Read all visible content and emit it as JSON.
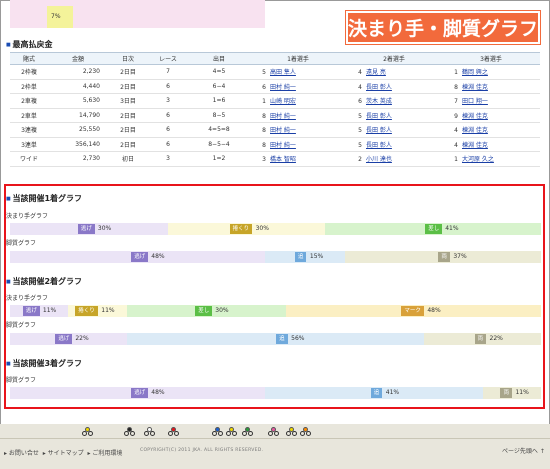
{
  "top_cell": "7%",
  "banner_title": "決まり手・脚質グラフ",
  "payout": {
    "title": "最高払戻金",
    "headers": [
      "賭式",
      "金額",
      "日次",
      "レース",
      "出目",
      "1着選手",
      "2着選手",
      "3着選手"
    ],
    "rows": [
      {
        "type": "2枠複",
        "amount": "2,230",
        "day": "2日目",
        "race": "7",
        "result": "4=5",
        "p1": {
          "num": "5",
          "name": "高田 隼人"
        },
        "p2": {
          "num": "4",
          "name": "遠見 亮"
        },
        "p3": {
          "num": "1",
          "name": "鶴岡 興之"
        }
      },
      {
        "type": "2枠単",
        "amount": "4,440",
        "day": "2日目",
        "race": "6",
        "result": "6−4",
        "p1": {
          "num": "6",
          "name": "田村 純一"
        },
        "p2": {
          "num": "4",
          "name": "長田 彰人"
        },
        "p3": {
          "num": "8",
          "name": "棟淵 佳克"
        }
      },
      {
        "type": "2車複",
        "amount": "5,630",
        "day": "3日目",
        "race": "3",
        "result": "1=6",
        "p1": {
          "num": "1",
          "name": "山崎 明宏"
        },
        "p2": {
          "num": "6",
          "name": "茨木 英成"
        },
        "p3": {
          "num": "7",
          "name": "田口 翔一"
        }
      },
      {
        "type": "2車単",
        "amount": "14,790",
        "day": "2日目",
        "race": "6",
        "result": "8−5",
        "p1": {
          "num": "8",
          "name": "田村 純一"
        },
        "p2": {
          "num": "5",
          "name": "長田 彰人"
        },
        "p3": {
          "num": "9",
          "name": "棟淵 佳克"
        }
      },
      {
        "type": "3連複",
        "amount": "25,550",
        "day": "2日目",
        "race": "6",
        "result": "4=5=8",
        "p1": {
          "num": "8",
          "name": "田村 純一"
        },
        "p2": {
          "num": "5",
          "name": "長田 彰人"
        },
        "p3": {
          "num": "4",
          "name": "棟淵 佳克"
        }
      },
      {
        "type": "3連単",
        "amount": "356,140",
        "day": "2日目",
        "race": "6",
        "result": "8−5−4",
        "p1": {
          "num": "8",
          "name": "田村 純一"
        },
        "p2": {
          "num": "5",
          "name": "長田 彰人"
        },
        "p3": {
          "num": "4",
          "name": "棟淵 佳克"
        }
      },
      {
        "type": "ワイド",
        "amount": "2,730",
        "day": "初日",
        "race": "3",
        "result": "1=2",
        "p1": {
          "num": "3",
          "name": "橋本 智昭"
        },
        "p2": {
          "num": "2",
          "name": "小川 達也"
        },
        "p3": {
          "num": "1",
          "name": "大河原 久之"
        }
      }
    ]
  },
  "graphs": [
    {
      "title": "当該開催1着グラフ",
      "rows": [
        {
          "label": "決まり手グラフ",
          "segments": [
            {
              "name": "逃げ",
              "value": 30,
              "bg": "#ebe4f6",
              "tag": "#8a78c8"
            },
            {
              "name": "捲くり",
              "value": 30,
              "bg": "#fbf8d9",
              "tag": "#c7a528"
            },
            {
              "name": "差し",
              "value": 41,
              "bg": "#d7f3cc",
              "tag": "#5bbf46"
            }
          ]
        },
        {
          "label": "脚質グラフ",
          "segments": [
            {
              "name": "逃げ",
              "value": 48,
              "bg": "#ebe4f6",
              "tag": "#8a78c8"
            },
            {
              "name": "追",
              "value": 15,
              "bg": "#dbeaf6",
              "tag": "#6fa9dc"
            },
            {
              "name": "両",
              "value": 37,
              "bg": "#ecebd6",
              "tag": "#a8a58a"
            }
          ]
        }
      ]
    },
    {
      "title": "当該開催2着グラフ",
      "rows": [
        {
          "label": "決まり手グラフ",
          "segments": [
            {
              "name": "逃げ",
              "value": 11,
              "bg": "#ebe4f6",
              "tag": "#8a78c8"
            },
            {
              "name": "捲くり",
              "value": 11,
              "bg": "#fbf8d9",
              "tag": "#c7a528"
            },
            {
              "name": "差し",
              "value": 30,
              "bg": "#d7f3cc",
              "tag": "#5bbf46"
            },
            {
              "name": "マーク",
              "value": 48,
              "bg": "#fbefc3",
              "tag": "#d9a13a"
            }
          ]
        },
        {
          "label": "脚質グラフ",
          "segments": [
            {
              "name": "逃げ",
              "value": 22,
              "bg": "#ebe4f6",
              "tag": "#8a78c8"
            },
            {
              "name": "追",
              "value": 56,
              "bg": "#dbeaf6",
              "tag": "#6fa9dc"
            },
            {
              "name": "両",
              "value": 22,
              "bg": "#ecebd6",
              "tag": "#a8a58a"
            }
          ]
        }
      ]
    },
    {
      "title": "当該開催3着グラフ",
      "rows": [
        {
          "label": "脚質グラフ",
          "segments": [
            {
              "name": "逃げ",
              "value": 48,
              "bg": "#ebe4f6",
              "tag": "#8a78c8"
            },
            {
              "name": "追",
              "value": 41,
              "bg": "#dbeaf6",
              "tag": "#6fa9dc"
            },
            {
              "name": "両",
              "value": 11,
              "bg": "#ecebd6",
              "tag": "#a8a58a"
            }
          ]
        }
      ]
    }
  ],
  "footer": {
    "link_contact": "お問い合せ",
    "link_sitemap": "サイトマップ",
    "link_env": "ご利用環境",
    "copyright": "COPYRIGHT(C) 2011 JKA. ALL RIGHTS RESERVED.",
    "page_top": "ページ先頭へ",
    "rider_colors": [
      "#f0d800",
      "#222222",
      "#ffffff",
      "#e8141b",
      "#1a5fd0",
      "#f0d800",
      "#2a9a3a",
      "#e85aa0",
      "#f0d800",
      "#ff8c00"
    ]
  }
}
